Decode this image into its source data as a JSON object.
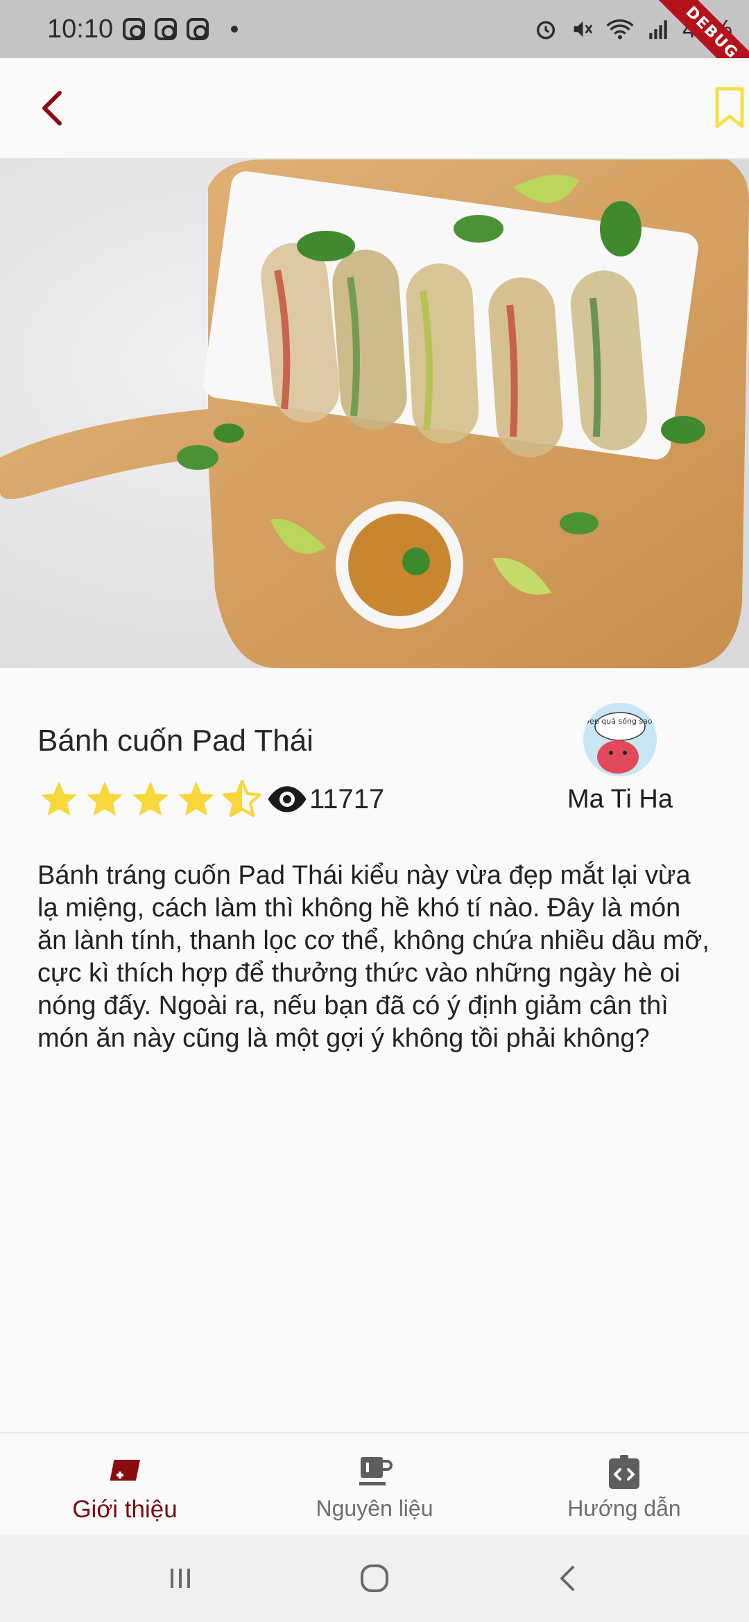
{
  "status_bar": {
    "time": "10:10",
    "battery": "46%",
    "debug_label": "DEBUG"
  },
  "recipe": {
    "title": "Bánh cuốn Pad Thái",
    "rating": 4.5,
    "rating_max": 5,
    "views": "11717",
    "author": "Ma Ti Ha",
    "avatar_caption": "Đẹp quá sống sao?",
    "description": "Bánh tráng cuốn Pad Thái kiểu này vừa đẹp mắt lại vừa lạ miệng, cách làm thì không hề khó tí nào. Đây là món ăn lành tính, thanh lọc cơ thể, không chứa nhiều dầu mỡ, cực kì thích hợp để thưởng thức vào những ngày hè oi nóng đấy. Ngoài ra, nếu bạn đã có ý định giảm cân thì món ăn này cũng là một gợi ý không tồi phải không?"
  },
  "bottom_nav": {
    "tabs": [
      {
        "label": "Giới thiệu",
        "icon": "recipe-book-icon",
        "active": true
      },
      {
        "label": "Nguyên liệu",
        "icon": "cup-icon",
        "active": false
      },
      {
        "label": "Hướng dẫn",
        "icon": "clipboard-code-icon",
        "active": false
      }
    ]
  },
  "colors": {
    "accent": "#8b0c0f",
    "star": "#f7d739",
    "bookmark": "#f5e04a"
  }
}
